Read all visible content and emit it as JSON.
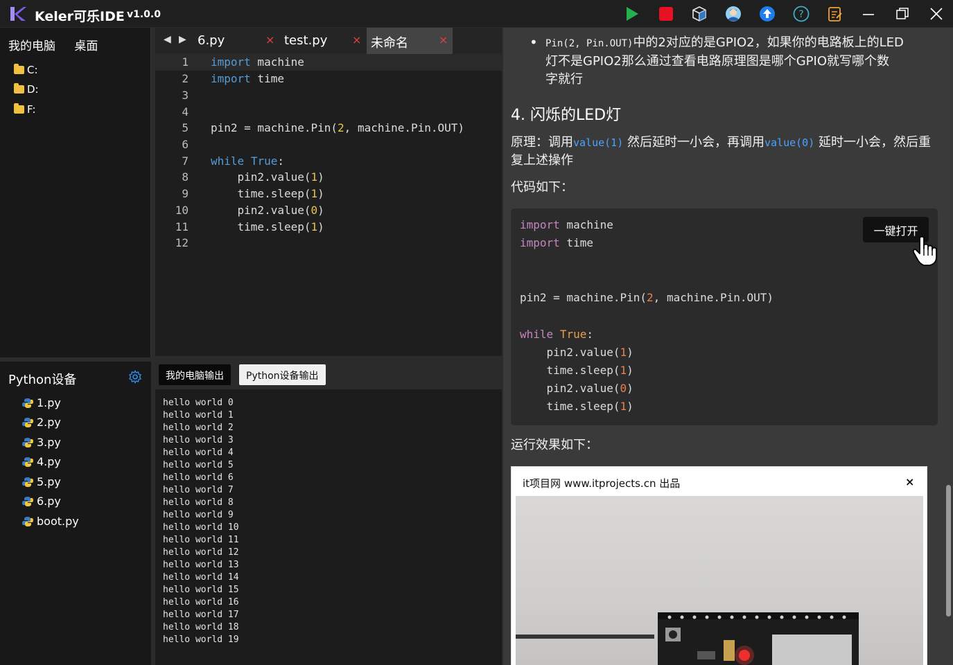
{
  "app": {
    "title": "Keler可乐IDE",
    "version": "v1.0.0"
  },
  "toolbar": {
    "icons": [
      "run-icon",
      "stop-icon",
      "package-icon",
      "user-avatar-icon",
      "upload-icon",
      "help-icon",
      "notes-icon",
      "minimize-icon",
      "restore-icon",
      "close-icon"
    ],
    "colors": {
      "run": "#22b14c",
      "stop": "#e81123",
      "upload": "#1e7ef0",
      "help": "#3ab0c8",
      "notes": "#f0a030"
    }
  },
  "left": {
    "tabs": [
      "我的电脑",
      "桌面"
    ],
    "drives": [
      "C:",
      "D:",
      "F:"
    ]
  },
  "devices": {
    "title": "Python设备",
    "files": [
      "1.py",
      "2.py",
      "3.py",
      "4.py",
      "5.py",
      "6.py",
      "boot.py"
    ]
  },
  "editor": {
    "tabs": [
      {
        "label": "6.py",
        "close": "×"
      },
      {
        "label": "test.py",
        "close": "×"
      },
      {
        "label": "未命名",
        "close": "×"
      }
    ],
    "lines": [
      {
        "n": "1",
        "kw": "import",
        "rest": " machine"
      },
      {
        "n": "2",
        "kw": "import",
        "rest": " time"
      },
      {
        "n": "3",
        "kw": "",
        "rest": ""
      },
      {
        "n": "4",
        "kw": "",
        "rest": ""
      },
      {
        "n": "5",
        "kw": "",
        "rest": "pin2 = machine.Pin(",
        "num": "2",
        "rest2": ", machine.Pin.OUT)"
      },
      {
        "n": "6",
        "kw": "",
        "rest": ""
      },
      {
        "n": "7",
        "kw": "while",
        "rest": " ",
        "kw2": "True",
        "rest2": ":"
      },
      {
        "n": "8",
        "kw": "",
        "rest": "    pin2.value(",
        "num": "1",
        "rest2": ")"
      },
      {
        "n": "9",
        "kw": "",
        "rest": "    time.sleep(",
        "num": "1",
        "rest2": ")"
      },
      {
        "n": "10",
        "kw": "",
        "rest": "    pin2.value(",
        "num": "0",
        "rest2": ")"
      },
      {
        "n": "11",
        "kw": "",
        "rest": "    time.sleep(",
        "num": "1",
        "rest2": ")"
      },
      {
        "n": "12",
        "kw": "",
        "rest": ""
      }
    ]
  },
  "output": {
    "tabs": [
      "我的电脑输出",
      "Python设备输出"
    ],
    "lines": [
      "hello world 0",
      "hello world 1",
      "hello world 2",
      "hello world 3",
      "hello world 4",
      "hello world 5",
      "hello world 6",
      "hello world 7",
      "hello world 8",
      "hello world 9",
      "hello world 10",
      "hello world 11",
      "hello world 12",
      "hello world 13",
      "hello world 14",
      "hello world 15",
      "hello world 16",
      "hello world 17",
      "hello world 18",
      "hello world 19"
    ]
  },
  "doc": {
    "bullet_code": "Pin(2, Pin.OUT)",
    "bullet_text1": "中的2对应的是GPIO2，如果你的电路板上的LED",
    "bullet_text2": "灯不是GPIO2那么通过查看电路原理图是哪个GPIO就写哪个数",
    "bullet_text3": "字就行",
    "heading": "4. 闪烁的LED灯",
    "principle_a": "原理：调用",
    "principle_code1": "value(1)",
    "principle_b": "然后延时一小会，再调用",
    "principle_code2": "value(0)",
    "principle_c": "延时一小会，然后重",
    "principle_d": "复上述操作",
    "code_label": "代码如下：",
    "open_button": "一键打开",
    "result_label": "运行效果如下：",
    "image_caption": "it项目网 www.itprojects.cn 出品",
    "image_close": "×"
  }
}
